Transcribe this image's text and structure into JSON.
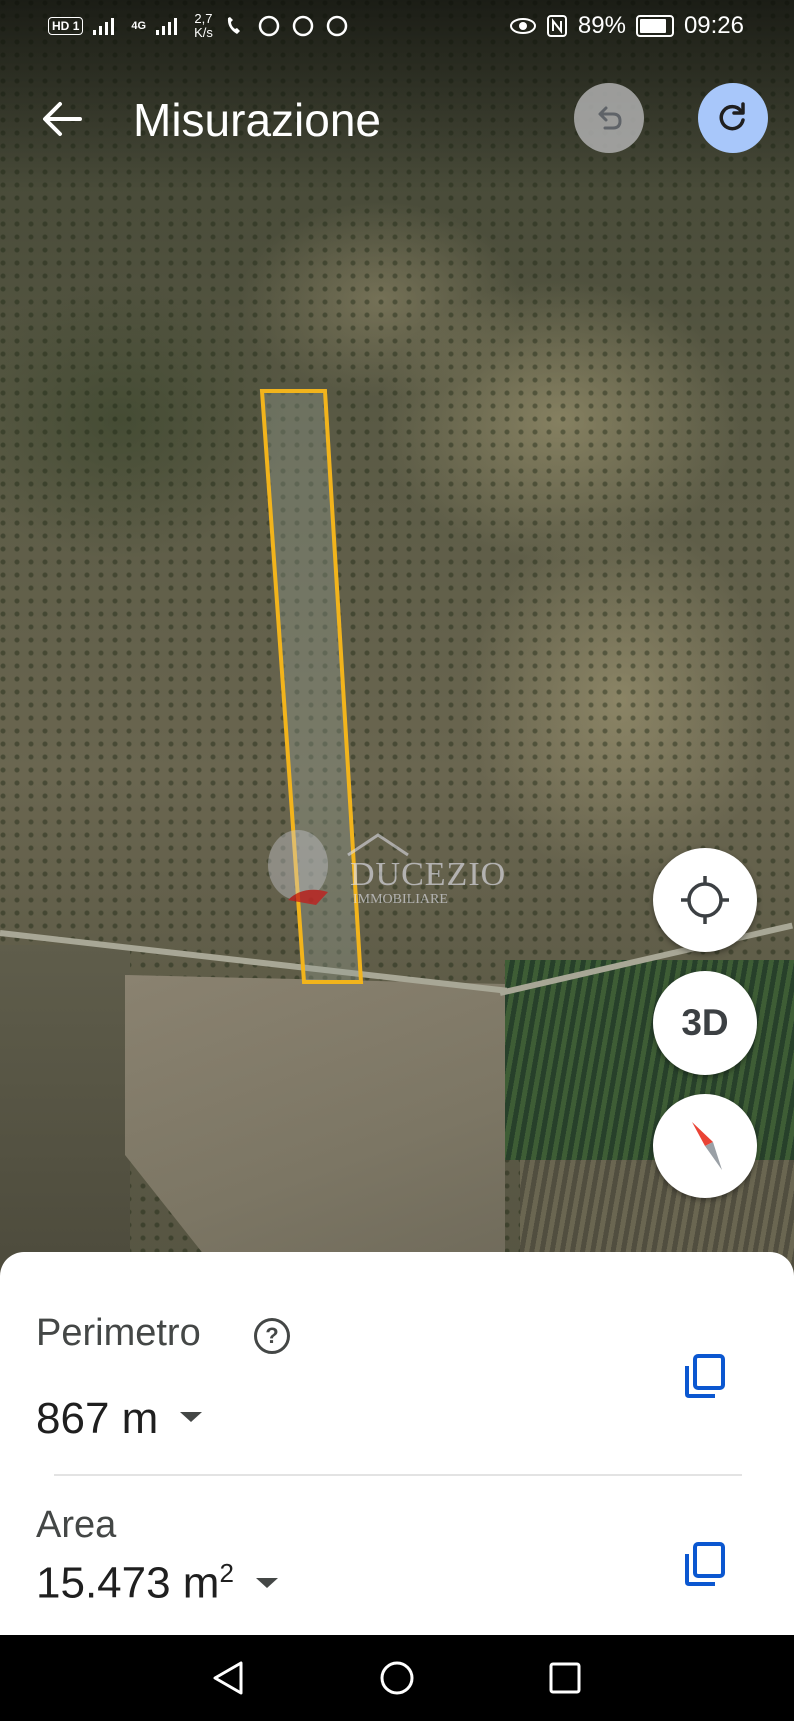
{
  "status_bar": {
    "sim_badge": "HD",
    "sim_slot": "1",
    "network": "4G",
    "speed_value": "2,7",
    "speed_unit": "K/s",
    "battery": "89%",
    "time": "09:26",
    "icons": [
      "signal-icon",
      "wifi-calling-icon",
      "whatsapp-icon",
      "circle-icon",
      "eye-icon",
      "nfc-icon",
      "battery-icon"
    ]
  },
  "app_bar": {
    "title": "Misurazione",
    "back_icon": "arrow-left-icon",
    "undo_icon": "undo-icon",
    "redo_icon": "redo-icon"
  },
  "map": {
    "watermark_text": "DUCEZIO",
    "watermark_subtext": "IMMOBILIARE",
    "plot_outline_color": "#f2b41c"
  },
  "map_controls": {
    "locate_icon": "crosshair-icon",
    "view_3d_label": "3D",
    "compass_icon": "compass-icon"
  },
  "measurement": {
    "perimeter_label": "Perimetro",
    "perimeter_value": "867 m",
    "area_label": "Area",
    "area_value": "15.473 m",
    "area_unit_sup": "2",
    "help_icon": "help-icon",
    "copy_icon": "copy-icon"
  },
  "nav_bar": {
    "icons": [
      "back-triangle-icon",
      "home-circle-icon",
      "recents-square-icon"
    ]
  },
  "colors": {
    "accent": "#a8c7fa",
    "icon_blue": "#0b57d0",
    "compass_red": "#ea4335"
  }
}
